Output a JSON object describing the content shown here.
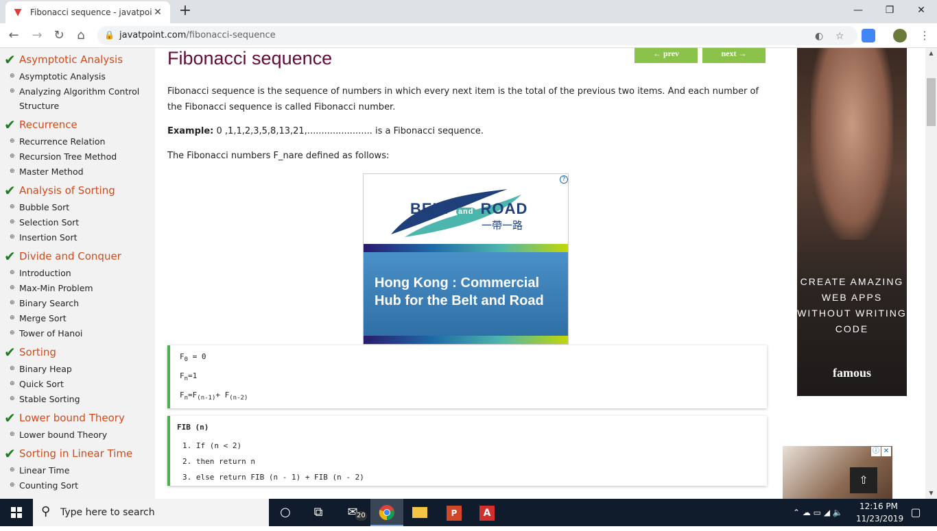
{
  "browser": {
    "tab_title": "Fibonacci sequence - javatpoint",
    "tab_close": "✕",
    "new_tab": "+",
    "url_domain": "javatpoint.com",
    "url_path": "/fibonacci-sequence",
    "win_min": "—",
    "win_restore": "❐",
    "win_close": "✕"
  },
  "sidebar": {
    "sections": [
      {
        "title": "Asymptotic Analysis",
        "items": [
          "Asymptotic Analysis",
          "Analyzing Algorithm Control Structure"
        ]
      },
      {
        "title": "Recurrence",
        "items": [
          "Recurrence Relation",
          "Recursion Tree Method",
          "Master Method"
        ]
      },
      {
        "title": "Analysis of Sorting",
        "items": [
          "Bubble Sort",
          "Selection Sort",
          "Insertion Sort"
        ]
      },
      {
        "title": "Divide and Conquer",
        "items": [
          "Introduction",
          "Max-Min Problem",
          "Binary Search",
          "Merge Sort",
          "Tower of Hanoi"
        ]
      },
      {
        "title": "Sorting",
        "items": [
          "Binary Heap",
          "Quick Sort",
          "Stable Sorting"
        ]
      },
      {
        "title": "Lower bound Theory",
        "items": [
          "Lower bound Theory"
        ]
      },
      {
        "title": "Sorting in Linear Time",
        "items": [
          "Linear Time",
          "Counting Sort"
        ]
      }
    ]
  },
  "article": {
    "title": "Fibonacci sequence",
    "prev": "← prev",
    "next": "next →",
    "intro": "Fibonacci sequence is the sequence of numbers in which every next item is the total of the previous two items. And each number of the Fibonacci sequence is called Fibonacci number.",
    "example_label": "Example:",
    "example_text": " 0 ,1,1,2,3,5,8,13,21,....................... is a Fibonacci sequence.",
    "defined": "The Fibonacci numbers F_nare defined as follows:",
    "formula": {
      "l1_a": "F",
      "l1_sub": "0",
      "l1_b": " = 0",
      "l2_a": "F",
      "l2_sub": "n",
      "l2_b": "=1",
      "l3_a": "F",
      "l3_sub1": "n",
      "l3_b": "=F",
      "l3_sub2": "(n-1)",
      "l3_c": "+ F",
      "l3_sub3": "(n-2)"
    },
    "code": {
      "head": "FIB (n)",
      "lines": [
        "If (n < 2)",
        "then return n",
        "else return FIB (n - 1) + FIB (n - 2)"
      ]
    }
  },
  "ads": {
    "belt_brand_a": "BELT",
    "belt_brand_and": "and",
    "belt_brand_b": "ROAD",
    "belt_cn": "一帶一路",
    "belt_text_1": "Hong Kong : Commercial",
    "belt_text_2": "Hub for the Belt and Road",
    "ad_info": "?",
    "right_text": "CREATE AMAZING WEB APPS WITHOUT WRITING CODE",
    "right_brand": "famous",
    "scroll_top": "⇧"
  },
  "taskbar": {
    "search_placeholder": "Type here to search",
    "mail_badge": "20",
    "time": "12:16 PM",
    "date": "11/23/2019"
  }
}
